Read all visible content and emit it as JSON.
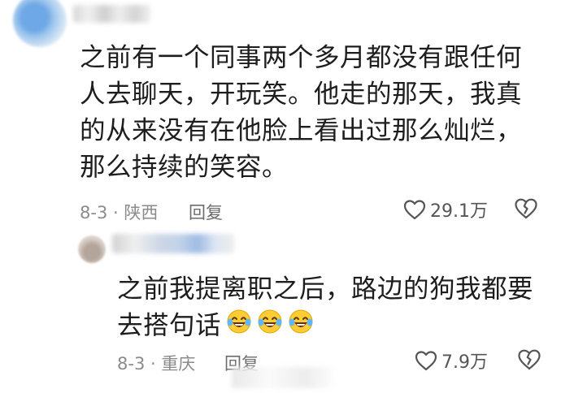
{
  "comments": [
    {
      "lines": [
        "之前有一个同事两个多月都没有跟任何",
        "人去聊天，开玩笑。他走的那天，我真",
        "的从来没有在他脸上看出过那么灿烂，",
        "那么持续的笑容。"
      ],
      "meta": "8-3 · 陕西",
      "reply_label": "回复",
      "likes": "29.1万"
    },
    {
      "lines": [
        "之前我提离职之后，路边的狗我都要",
        "去搭句话"
      ],
      "emojis": [
        "laughing-crying-emoji",
        "laughing-crying-emoji",
        "laughing-crying-emoji"
      ],
      "meta": "8-3 · 重庆",
      "reply_label": "回复",
      "likes": "7.9万"
    }
  ],
  "icons": {
    "like": "heart-outline-icon",
    "dislike": "broken-heart-icon"
  }
}
